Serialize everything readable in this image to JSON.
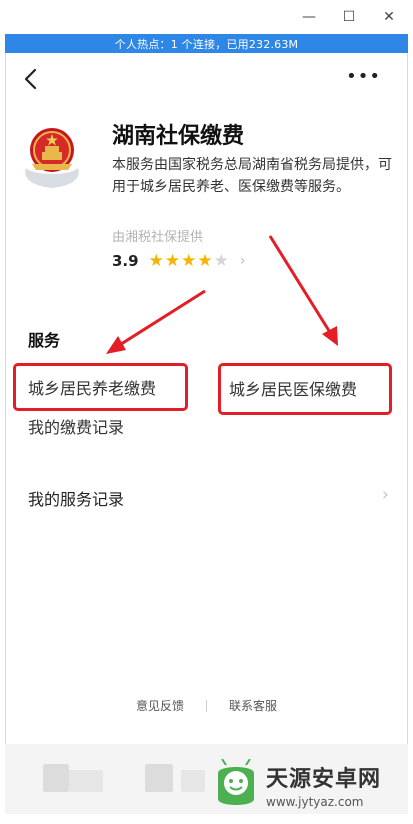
{
  "window": {
    "minimize_glyph": "—",
    "maximize_glyph": "☐",
    "close_glyph": "✕"
  },
  "status": {
    "hotspot_text": "个人热点：1 个连接，已用232.63M"
  },
  "header": {
    "back_icon": "back-arrow-icon",
    "more_label": "•••"
  },
  "app": {
    "title": "湖南社保缴费",
    "description": "本服务由国家税务总局湖南省税务局提供，可用于城乡居民养老、医保缴费等服务。",
    "provider": "由湘税社保提供",
    "rating": "3.9",
    "rating_value": 3.9,
    "rating_max": 5,
    "rating_chevron": "›"
  },
  "services": {
    "section_title": "服务",
    "items": [
      {
        "label": "城乡居民养老缴费"
      },
      {
        "label": "城乡居民医保缴费"
      },
      {
        "label": "我的缴费记录"
      }
    ]
  },
  "records": {
    "label": "我的服务记录",
    "chevron": "›"
  },
  "footer": {
    "feedback": "意见反馈",
    "support": "联系客服"
  },
  "watermark": {
    "name": "天源安卓网",
    "url": "www.jytyaz.com"
  },
  "colors": {
    "accent": "#2e86e6",
    "highlight": "#e41e26",
    "star": "#f5b400"
  }
}
